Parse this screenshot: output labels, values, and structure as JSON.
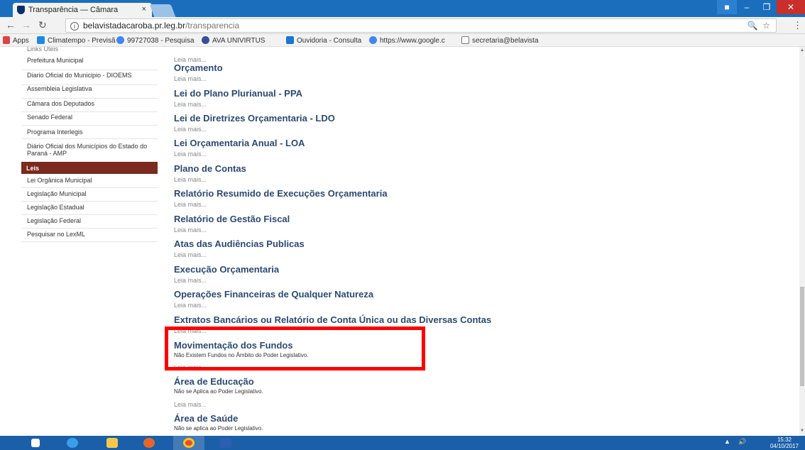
{
  "browser": {
    "tab_title": "Transparência — Câmara",
    "tab_close": "×",
    "url_host": "belavistadacaroba.pr.leg.br",
    "url_path": "/transparencia",
    "bookmarks": [
      {
        "label": "Apps",
        "icon": "apps-grid-icon"
      },
      {
        "label": "Climatempo - Previsã",
        "icon": "climatempo-icon"
      },
      {
        "label": "99727038 - Pesquisa",
        "icon": "google-icon"
      },
      {
        "label": "AVA UNIVIRTUS",
        "icon": "univirtus-icon"
      },
      {
        "label": "Ouvidoria - Consulta",
        "icon": "ouvidoria-icon"
      },
      {
        "label": "https://www.google.c",
        "icon": "google-icon"
      },
      {
        "label": "secretaria@belavista",
        "icon": "mail-icon"
      }
    ]
  },
  "sidebar": {
    "cut_heading": "Links Úteis",
    "links": [
      "Prefeitura Municipal",
      "Diario Oficial do Municipio - DIOEMS",
      "Assembleia Legislativa",
      "Câmara dos Deputados",
      "Senado Federal",
      "Programa Interlegis",
      "Diário Oficial dos Municípios do Estado do Paraná - AMP"
    ],
    "leis_header": "Leis",
    "leis": [
      "Lei Orgânica Municipal",
      "Legislação Municipal",
      "Legislação Estadual",
      "Legislação Federal",
      "Pesquisar no LexML"
    ]
  },
  "main": {
    "leia_mais": "Leia mais...",
    "sections": [
      {
        "title": "Orçamento",
        "desc": ""
      },
      {
        "title": "Lei do Plano Plurianual - PPA",
        "desc": ""
      },
      {
        "title": "Lei de Diretrizes Orçamentaria - LDO",
        "desc": ""
      },
      {
        "title": "Lei Orçamentaria Anual - LOA",
        "desc": ""
      },
      {
        "title": "Plano de Contas",
        "desc": ""
      },
      {
        "title": "Relatório Resumido de Execuções Orçamentaria",
        "desc": ""
      },
      {
        "title": "Relatório de Gestão Fiscal",
        "desc": ""
      },
      {
        "title": "Atas das Audiências Publicas",
        "desc": ""
      },
      {
        "title": "Execução Orçamentaria",
        "desc": ""
      },
      {
        "title": "Operações Financeiras de Qualquer Natureza",
        "desc": ""
      },
      {
        "title": "Extratos Bancários ou Relatório de Conta Única ou das Diversas Contas",
        "desc": ""
      },
      {
        "title": "Movimentação dos Fundos",
        "desc": "Não Existem Fundos no Âmbito do Poder Legislativo."
      },
      {
        "title": "Área de Educação",
        "desc": "Não se Aplica ao Poder Legislativo."
      },
      {
        "title": "Área de Saúde",
        "desc": "Não se aplica ao Poder Legislativo."
      }
    ]
  },
  "taskbar": {
    "time": "15:32",
    "date": "04/10/2017"
  },
  "colors": {
    "title_bar": "#1a6ebd",
    "sidebar_header": "#7a2a1e",
    "link_title": "#2b4a73",
    "highlight": "#ff0000",
    "taskbar": "#1b5fa8"
  }
}
